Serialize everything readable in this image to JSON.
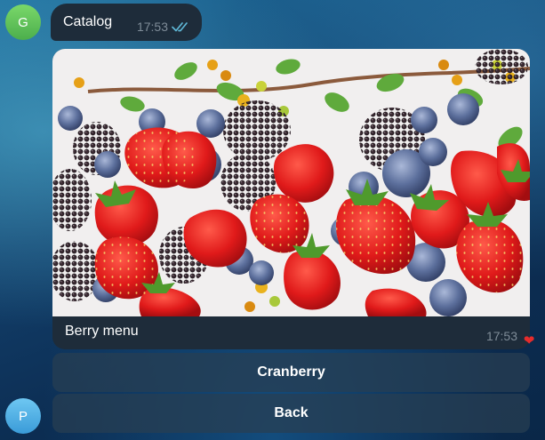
{
  "chat": {
    "messages": [
      {
        "avatar_letter": "G",
        "text": "Catalog",
        "time": "17:53",
        "status": "read-double-check"
      },
      {
        "caption": "Berry menu",
        "time": "17:53",
        "reaction": "❤"
      }
    ]
  },
  "keyboard": {
    "buttons": [
      {
        "label": "Cranberry"
      },
      {
        "label": "Back"
      }
    ]
  },
  "user": {
    "avatar_letter": "P"
  },
  "colors": {
    "bubble_bg": "#1e2c3a",
    "time_text": "#7f8c98",
    "check_color": "#5fb7d6",
    "avatar_g": "#5cbf5c",
    "avatar_p": "#4aa7e0",
    "reaction_heart": "#e62c2c"
  }
}
